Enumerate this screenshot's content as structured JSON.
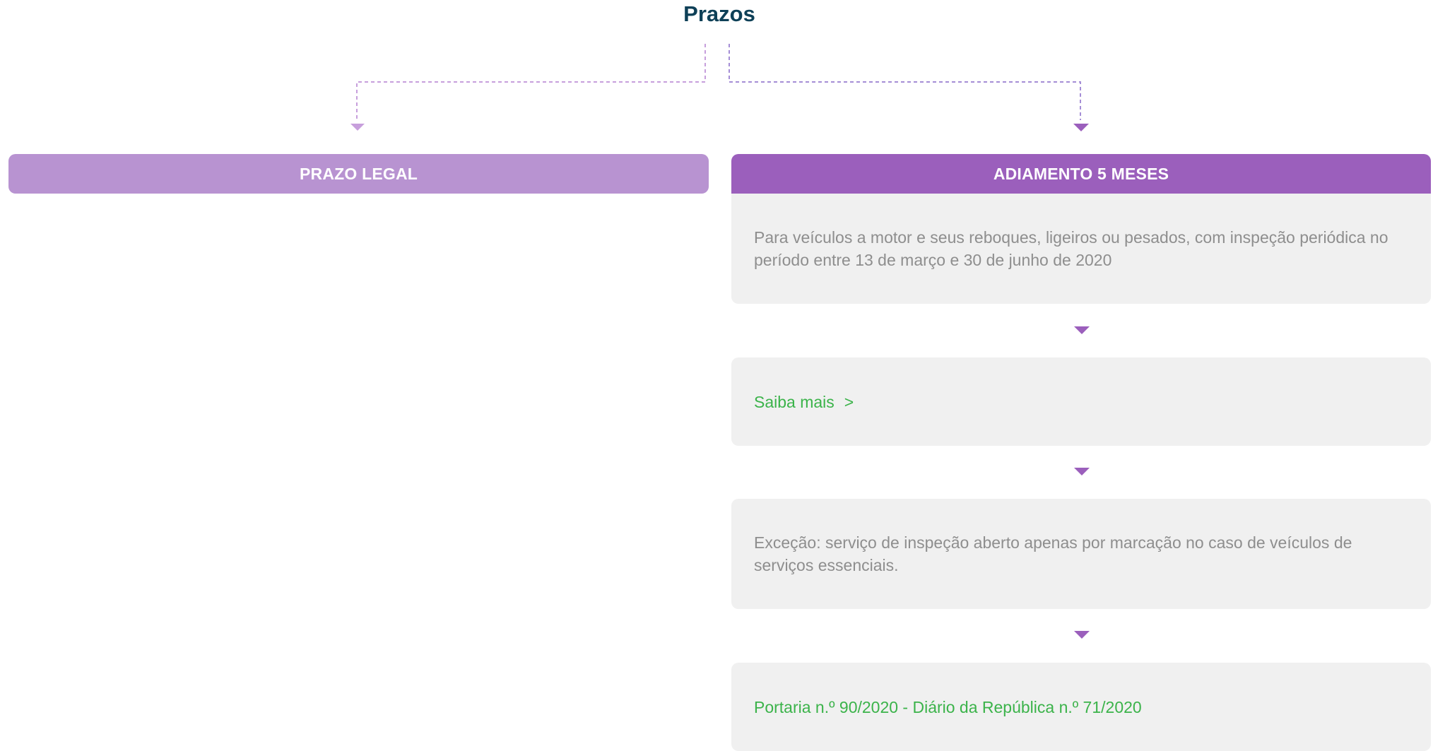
{
  "diagram": {
    "title": "Prazos",
    "left_branch": {
      "header": "PRAZO LEGAL"
    },
    "right_branch": {
      "header": "ADIAMENTO 5 MESES",
      "description": "Para veículos a motor e seus reboques, ligeiros ou pesados, com inspeção periódica no período entre 13 de março e 30 de junho de 2020",
      "more_link": "Saiba mais",
      "more_chevron": ">",
      "exception": "Exceção: serviço de inspeção aberto apenas por marcação no caso de veículos de serviços essenciais.",
      "legal_reference": "Portaria n.º 90/2020 - Diário da República n.º 71/2020"
    }
  },
  "colors": {
    "title": "#0e4057",
    "header_left": "#b893d1",
    "header_right": "#9b5fbc",
    "card_background": "#f0f0f0",
    "body_text": "#8e8e8e",
    "link_text": "#3bb34a",
    "arrow": "#9b5fbc"
  },
  "icons": {
    "flow_arrow": "triangle-down-icon",
    "link_chevron": "chevron-right-icon"
  }
}
